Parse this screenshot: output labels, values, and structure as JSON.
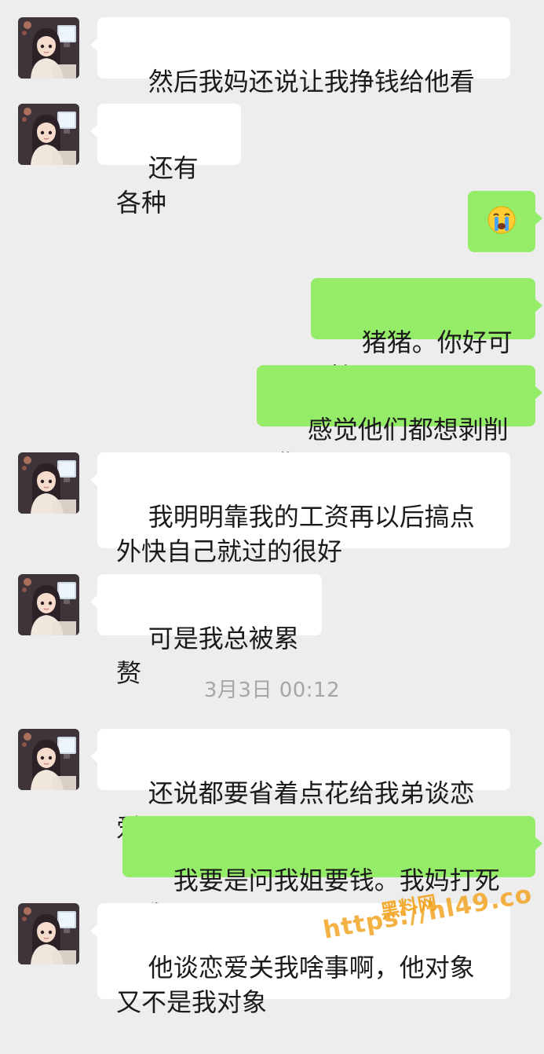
{
  "messages": [
    {
      "side": "left",
      "text": "然后我妈还说让我挣钱给他看牙"
    },
    {
      "side": "left",
      "text": "还有各种"
    },
    {
      "side": "right",
      "emoji": "crying-face"
    },
    {
      "side": "right",
      "text": "猪猪。你好可怜"
    },
    {
      "side": "right",
      "text": "感觉他们都想剥削你"
    },
    {
      "side": "left",
      "text": "我明明靠我的工资再以后搞点外快自己就过的很好"
    },
    {
      "side": "left",
      "text": "可是我总被累赘"
    },
    {
      "side": "left",
      "text": "还说都要省着点花给我弟谈恋爱"
    },
    {
      "side": "right",
      "text": "我要是问我姐要钱。我妈打死我"
    },
    {
      "side": "left",
      "text": "他谈恋爱关我啥事啊，他对象又不是我对象"
    }
  ],
  "timestamp": "3月3日 00:12",
  "watermark": {
    "title": "黑料网",
    "url": "https://hl49.co"
  },
  "colors": {
    "background": "#ededed",
    "bubble_left": "#ffffff",
    "bubble_right": "#95ec69",
    "timestamp": "#a6a6a6",
    "watermark": "#f2a21c"
  },
  "icons": {
    "avatar": "avatar-girl-at-desk",
    "emoji": "crying-face-emoji"
  }
}
